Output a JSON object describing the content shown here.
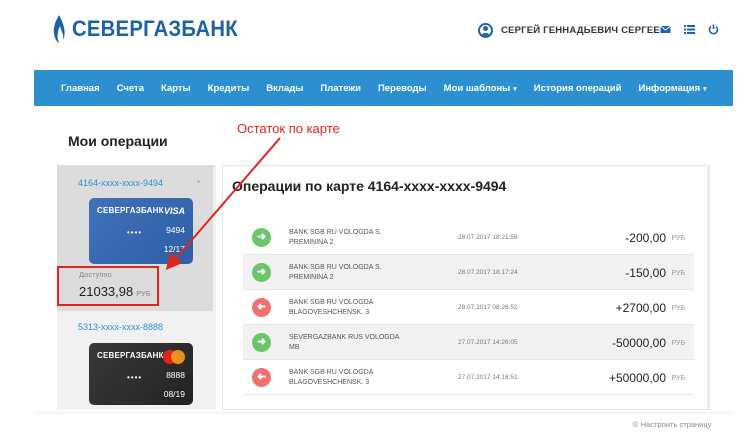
{
  "header": {
    "bank_name": "СЕВЕРГАЗБАНК",
    "user_name": "СЕРГЕЙ ГЕННАДЬЕВИЧ СЕРГЕЕВ",
    "icons": [
      "mail-icon",
      "list-icon",
      "power-icon"
    ]
  },
  "nav": {
    "items": [
      {
        "label": "Главная"
      },
      {
        "label": "Счета"
      },
      {
        "label": "Карты"
      },
      {
        "label": "Кредиты"
      },
      {
        "label": "Вклады"
      },
      {
        "label": "Платежи"
      },
      {
        "label": "Переводы"
      },
      {
        "label": "Мои шаблоны",
        "dropdown": true
      },
      {
        "label": "История операций"
      },
      {
        "label": "Информация",
        "dropdown": true
      }
    ]
  },
  "page": {
    "title": "Мои операции",
    "annotation": "Остаток по карте"
  },
  "cards": [
    {
      "number": "4164-xxxx-xxxx-9494",
      "bank_logo": "СЕВЕРГАЗБАНК",
      "brand": "VISA",
      "dots": "••••",
      "last4": "9494",
      "expiry": "12/17",
      "available_label": "Доступно",
      "available_amount": "21033,98",
      "currency": "РУБ"
    },
    {
      "number": "5313-xxxx-xxxx-8888",
      "bank_logo": "СЕВЕРГАЗБАНК",
      "brand": "mastercard",
      "dots": "••••",
      "last4": "8888",
      "expiry": "08/19"
    }
  ],
  "operations_panel": {
    "title": "Операции по карте 4164-xxxx-xxxx-9494",
    "rows": [
      {
        "direction": "in",
        "desc_line1": "BANK SGB RU VOLOGDA S.",
        "desc_line2": "PREMININA 2",
        "date": "28.07.2017 18:21:58",
        "amount": "-200,00",
        "currency": "РУБ"
      },
      {
        "direction": "in",
        "desc_line1": "BANK SGB RU VOLOGDA S.",
        "desc_line2": "PREMININA 2",
        "date": "28.07.2017 18:17:24",
        "amount": "-150,00",
        "currency": "РУБ"
      },
      {
        "direction": "out",
        "desc_line1": "BANK SGB RU VOLOGDA",
        "desc_line2": "BLAGOVESHCHENSK. 3",
        "date": "28.07.2017 08:26:52",
        "amount": "+2700,00",
        "currency": "РУБ"
      },
      {
        "direction": "in",
        "desc_line1": "SEVERGAZBANK RUS VOLOGDA",
        "desc_line2": "MB",
        "date": "27.07.2017 14:26:05",
        "amount": "-50000,00",
        "currency": "РУБ"
      },
      {
        "direction": "out",
        "desc_line1": "BANK SGB RU VOLOGDA",
        "desc_line2": "BLAGOVESHCHENSK. 3",
        "date": "27.07.2017 14:16:51",
        "amount": "+50000,00",
        "currency": "РУБ"
      }
    ]
  },
  "footer": {
    "customize_label": "Настроить страницу"
  },
  "colors": {
    "brand_blue": "#1e62a6",
    "nav_blue": "#2b8fd0",
    "annotation_red": "#e0261b",
    "incoming_green": "#6cc46b",
    "outgoing_red": "#f07070"
  }
}
